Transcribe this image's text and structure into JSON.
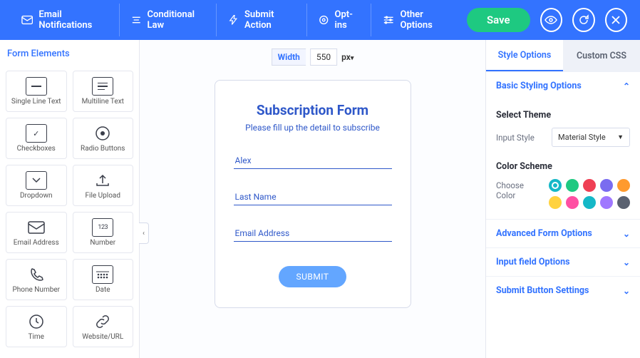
{
  "topbar": {
    "items": [
      {
        "label": "Email Notifications"
      },
      {
        "label": "Conditional Law"
      },
      {
        "label": "Submit Action"
      },
      {
        "label": "Opt-ins"
      },
      {
        "label": "Other Options"
      }
    ],
    "save": "Save"
  },
  "left": {
    "title": "Form Elements",
    "elements": [
      {
        "label": "Single Line Text"
      },
      {
        "label": "Multiline Text"
      },
      {
        "label": "Checkboxes"
      },
      {
        "label": "Radio Buttons"
      },
      {
        "label": "Dropdown"
      },
      {
        "label": "File Upload"
      },
      {
        "label": "Email Address"
      },
      {
        "label": "Number"
      },
      {
        "label": "Phone Number"
      },
      {
        "label": "Date"
      },
      {
        "label": "Time"
      },
      {
        "label": "Website/URL"
      }
    ]
  },
  "center": {
    "width_label": "Width",
    "width_value": "550",
    "width_unit": "px",
    "form": {
      "title": "Subscription Form",
      "subtitle": "Please fill up the detail to subscribe",
      "first_name_value": "Alex",
      "last_name_placeholder": "Last Name",
      "email_placeholder": "Email Address",
      "submit": "SUBMIT"
    }
  },
  "right": {
    "tabs": {
      "style": "Style Options",
      "css": "Custom CSS"
    },
    "basic": {
      "header": "Basic Styling Options",
      "select_theme": "Select Theme",
      "input_style_label": "Input Style",
      "input_style_value": "Material Style",
      "color_scheme": "Color Scheme",
      "choose_color": "Choose Color",
      "colors": [
        "#15b8c7",
        "#1ec981",
        "#ef3f54",
        "#7a6cf0",
        "#ff9a2e",
        "#ffd23f",
        "#ff4fa3",
        "#15b8c7",
        "#a078ff",
        "#5a6170"
      ]
    },
    "advanced": "Advanced Form Options",
    "input_field": "Input field Options",
    "submit_btn": "Submit Button Settings"
  }
}
